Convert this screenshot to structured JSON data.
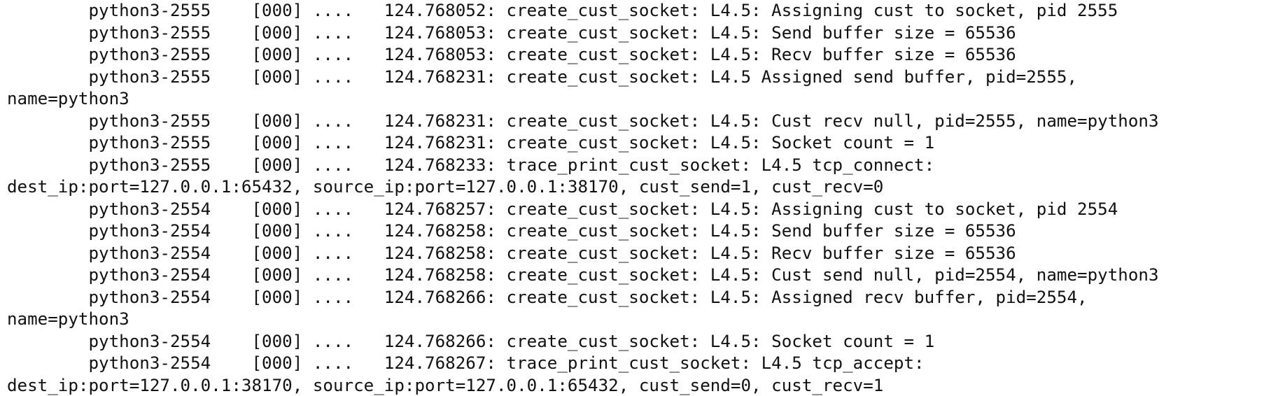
{
  "terminal": {
    "lines": [
      "        python3-2555    [000] ....   124.768052: create_cust_socket: L4.5: Assigning cust to socket, pid 2555",
      "        python3-2555    [000] ....   124.768053: create_cust_socket: L4.5: Send buffer size = 65536",
      "        python3-2555    [000] ....   124.768053: create_cust_socket: L4.5: Recv buffer size = 65536",
      "        python3-2555    [000] ....   124.768231: create_cust_socket: L4.5 Assigned send buffer, pid=2555,",
      "name=python3",
      "        python3-2555    [000] ....   124.768231: create_cust_socket: L4.5: Cust recv null, pid=2555, name=python3",
      "        python3-2555    [000] ....   124.768231: create_cust_socket: L4.5: Socket count = 1",
      "        python3-2555    [000] ....   124.768233: trace_print_cust_socket: L4.5 tcp_connect:",
      "dest_ip:port=127.0.0.1:65432, source_ip:port=127.0.0.1:38170, cust_send=1, cust_recv=0",
      "        python3-2554    [000] ....   124.768257: create_cust_socket: L4.5: Assigning cust to socket, pid 2554",
      "        python3-2554    [000] ....   124.768258: create_cust_socket: L4.5: Send buffer size = 65536",
      "        python3-2554    [000] ....   124.768258: create_cust_socket: L4.5: Recv buffer size = 65536",
      "        python3-2554    [000] ....   124.768258: create_cust_socket: L4.5: Cust send null, pid=2554, name=python3",
      "        python3-2554    [000] ....   124.768266: create_cust_socket: L4.5: Assigned recv buffer, pid=2554,",
      "name=python3",
      "        python3-2554    [000] ....   124.768266: create_cust_socket: L4.5: Socket count = 1",
      "        python3-2554    [000] ....   124.768267: trace_print_cust_socket: L4.5 tcp_accept:",
      "dest_ip:port=127.0.0.1:38170, source_ip:port=127.0.0.1:65432, cust_send=0, cust_recv=1"
    ]
  }
}
